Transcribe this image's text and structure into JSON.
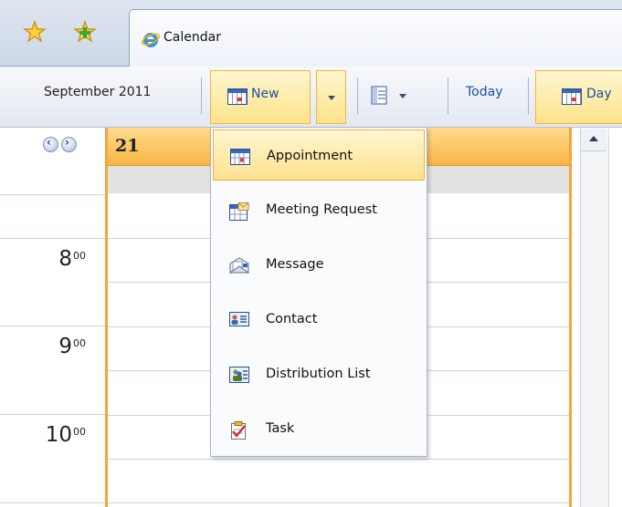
{
  "browser": {
    "tab_title": "Calendar",
    "favorites_icon": "favorites-star-icon",
    "add_favorites_icon": "add-favorites-icon",
    "tab_icon": "internet-explorer-icon"
  },
  "toolbar": {
    "month_label": "September 2011",
    "new_label": "New",
    "today_label": "Today",
    "day_label": "Day"
  },
  "calendar": {
    "day_number": "21",
    "hours": [
      {
        "hour": "8",
        "minutes": "00"
      },
      {
        "hour": "9",
        "minutes": "00"
      },
      {
        "hour": "10",
        "minutes": "00"
      }
    ]
  },
  "menu": {
    "items": [
      {
        "label": "Appointment",
        "icon": "appointment-icon",
        "selected": true
      },
      {
        "label": "Meeting Request",
        "icon": "meeting-request-icon",
        "selected": false
      },
      {
        "label": "Message",
        "icon": "message-icon",
        "selected": false
      },
      {
        "label": "Contact",
        "icon": "contact-icon",
        "selected": false
      },
      {
        "label": "Distribution List",
        "icon": "distribution-list-icon",
        "selected": false
      },
      {
        "label": "Task",
        "icon": "task-icon",
        "selected": false
      }
    ]
  },
  "colors": {
    "accent_orange": "#f6a53a",
    "highlight_yellow": "#fde38b",
    "link_blue": "#1f4fa3"
  }
}
